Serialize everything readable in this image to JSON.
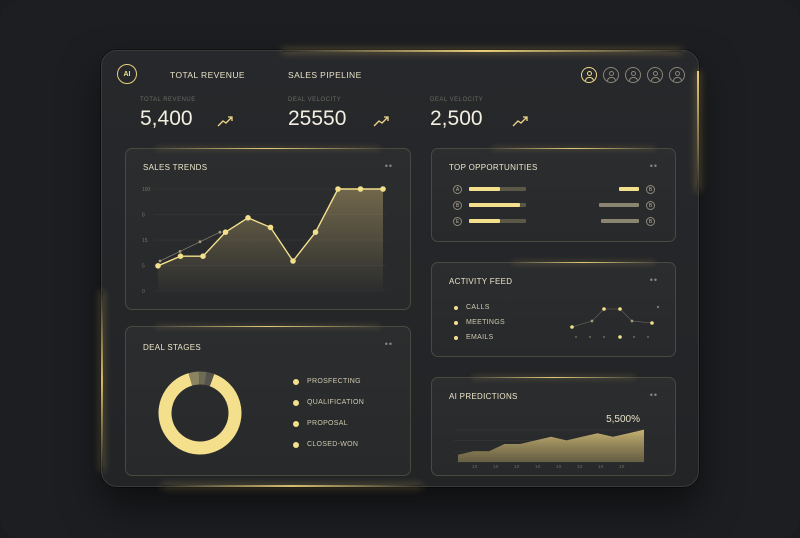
{
  "nav": {
    "logo_text": "AI",
    "items": [
      "TOTAL REVENUE",
      "SALES PIPELINE"
    ]
  },
  "avatars": [
    "user-1",
    "user-2",
    "user-3",
    "user-4",
    "user-5"
  ],
  "kpis": [
    {
      "label": "TOTAL REVENUE",
      "value": "5,400"
    },
    {
      "label": "DEAL VELOCITY",
      "value": "25550"
    },
    {
      "label": "DEAL VELOCITY",
      "value": "2,500"
    }
  ],
  "sales_trends": {
    "title": "SALES TRENDS",
    "menu": "••",
    "y_ticks": [
      "100",
      "8",
      "15",
      "5",
      "0"
    ],
    "chart_data": {
      "type": "line",
      "series": [
        {
          "values": [
            2,
            3,
            3,
            5.5,
            7,
            6,
            2.5,
            5.5,
            10,
            10,
            10
          ]
        },
        {
          "values": [
            2.5,
            3.5,
            4.5,
            5.5
          ]
        }
      ]
    }
  },
  "deal_stages": {
    "title": "DEAL STAGES",
    "menu": "••",
    "chart_data": {
      "type": "pie",
      "categories": [
        "PROSFECTING",
        "QUALIFICATION",
        "PROPOSAL",
        "CLOSED-WON"
      ],
      "values": [
        90,
        4,
        3,
        3
      ]
    },
    "legend": [
      "PROSFECTING",
      "QUALIFICATION",
      "PROPOSAL",
      "CLOSED-WON"
    ]
  },
  "top_opportunities": {
    "title": "TOP OPPORTUNITIES",
    "menu": "••",
    "rows": [
      {
        "badge": "A",
        "left_fill": 0.55,
        "right_fill": 0.5,
        "right_badge": "B"
      },
      {
        "badge": "B",
        "left_fill": 0.9,
        "right_fill": 1.0,
        "right_badge": "B"
      },
      {
        "badge": "E",
        "left_fill": 0.55,
        "right_fill": 0.95,
        "right_badge": "B"
      }
    ]
  },
  "activity_feed": {
    "title": "ACTIVITY FEED",
    "menu": "••",
    "items": [
      "CALLS",
      "MEETINGS",
      "EMAILS"
    ]
  },
  "ai_predictions": {
    "title": "AI PREDICTIONS",
    "menu": "••",
    "value": "5,500%",
    "x_ticks": [
      "1X",
      "1X",
      "1X",
      "1X",
      "1X",
      "1X",
      "1X",
      "1X"
    ],
    "chart_data": {
      "type": "area",
      "values": [
        2,
        3,
        3,
        5,
        5,
        6,
        7,
        6,
        7,
        8,
        7,
        8,
        9
      ]
    }
  },
  "colors": {
    "accent": "#f3df8c",
    "background": "#1a1c1f",
    "card": "#2a2c2e"
  }
}
